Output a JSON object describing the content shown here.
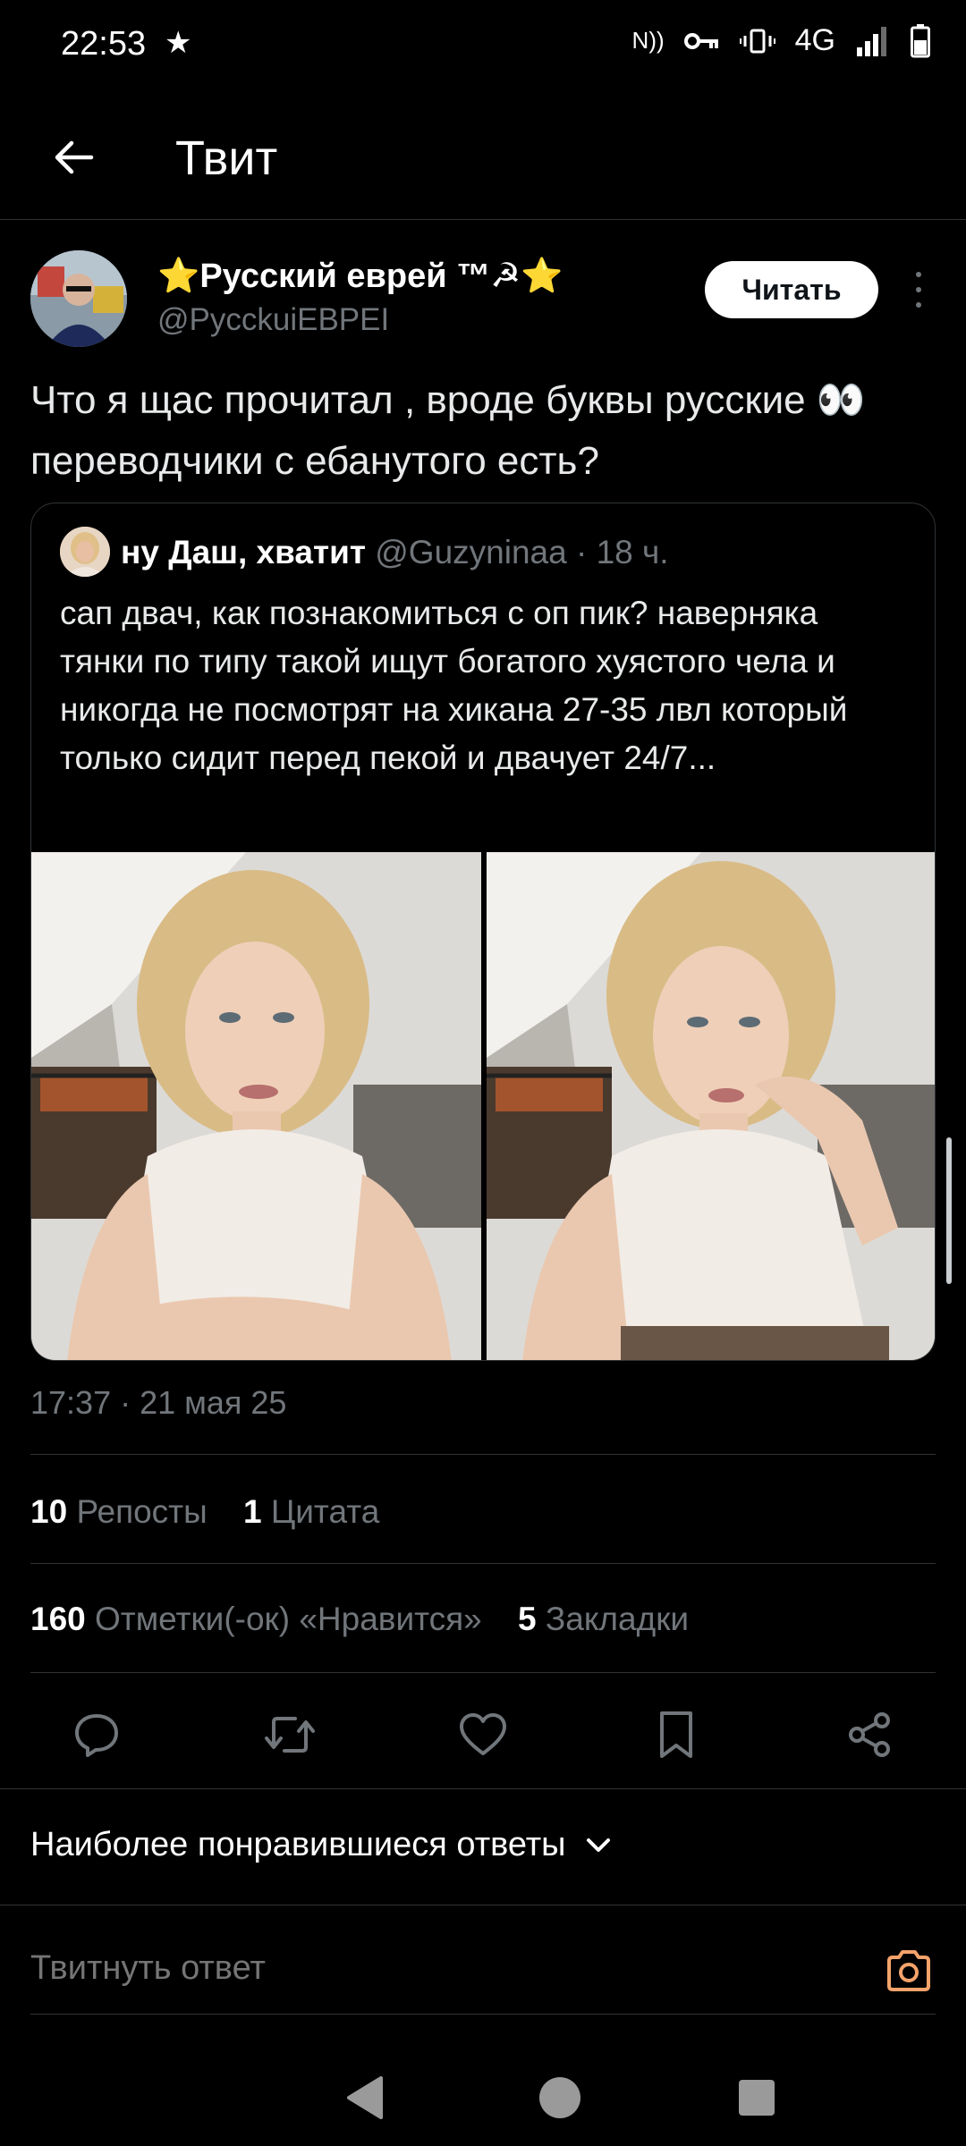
{
  "status_bar": {
    "time": "22:53",
    "star": "★",
    "nfc": "N))",
    "network": "4G"
  },
  "header": {
    "title": "Твит",
    "back_icon": "arrow-left-icon"
  },
  "tweet": {
    "author_name": "⭐Русский еврей ™☭⭐",
    "author_handle": "@PycckuiEBPEI",
    "follow_label": "Читать",
    "text": "Что я щас прочитал , вроде буквы русские 👀 переводчики с ебанутого есть?",
    "timestamp": "17:37 · 21 мая 25"
  },
  "quote": {
    "author_name": "ну Даш, хватит",
    "author_handle": "@Guzyninaa · 18 ч.",
    "text": "сап двач, как познакомиться с оп пик? наверняка тянки по типу такой ищут богатого хуястого чела и никогда не посмотрят на хикана 27-35 лвл который только сидит перед пекой и двачует 24/7..."
  },
  "stats": {
    "reposts_count": "10",
    "reposts_label": "Репосты",
    "quotes_count": "1",
    "quotes_label": "Цитата",
    "likes_count": "160",
    "likes_label": "Отметки(-ок) «Нравится»",
    "bookmarks_count": "5",
    "bookmarks_label": "Закладки"
  },
  "actions": [
    "reply-icon",
    "retweet-icon",
    "like-icon",
    "bookmark-icon",
    "share-icon"
  ],
  "replies": {
    "sort_label": "Наиболее понравившиеся ответы",
    "input_placeholder": "Твитнуть ответ"
  },
  "colors": {
    "background": "#000000",
    "text": "#e7e9ea",
    "secondary": "#71767b",
    "accent_camera": "#f4a36b"
  }
}
